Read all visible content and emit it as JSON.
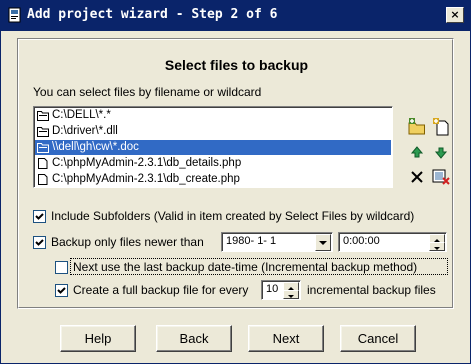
{
  "window": {
    "title": "Add project wizard - Step 2 of 6",
    "close_label": "×"
  },
  "panel": {
    "heading": "Select files to backup",
    "subheading": "You can select files by filename or wildcard"
  },
  "file_list": {
    "items": [
      {
        "label": "C:\\DELL\\*.*",
        "icon": "folder-icon",
        "selected": false
      },
      {
        "label": "D:\\driver\\*.dll",
        "icon": "folder-icon",
        "selected": false
      },
      {
        "label": "\\\\dell\\gh\\cw\\*.doc",
        "icon": "folder-icon",
        "selected": true
      },
      {
        "label": "C:\\phpMyAdmin-2.3.1\\db_details.php",
        "icon": "file-icon",
        "selected": false
      },
      {
        "label": "C:\\phpMyAdmin-2.3.1\\db_create.php",
        "icon": "file-icon",
        "selected": false
      }
    ]
  },
  "toolbar": {
    "add_folder": "add-folder-icon",
    "add_file": "add-file-icon",
    "move_up": "arrow-up-icon",
    "move_down": "arrow-down-icon",
    "delete": "delete-icon",
    "clear_all": "clear-list-icon"
  },
  "options": {
    "include_subfolders": {
      "label": "Include Subfolders (Valid in item created by Select Files by wildcard)",
      "checked": true
    },
    "newer_than": {
      "label": "Backup only files newer than",
      "checked": true,
      "date": "1980- 1- 1",
      "time": "0:00:00"
    },
    "last_backup": {
      "label": "Next use the last backup date-time (Incremental backup method)",
      "checked": false
    },
    "full_backup": {
      "label_before": "Create a full backup file for every",
      "value": "10",
      "label_after": "incremental backup files",
      "checked": true
    }
  },
  "buttons": {
    "help": "Help",
    "back": "Back",
    "next": "Next",
    "cancel": "Cancel"
  },
  "colors": {
    "titlebar": "#0a246a",
    "selection": "#316ac5",
    "face": "#ece9d8"
  }
}
